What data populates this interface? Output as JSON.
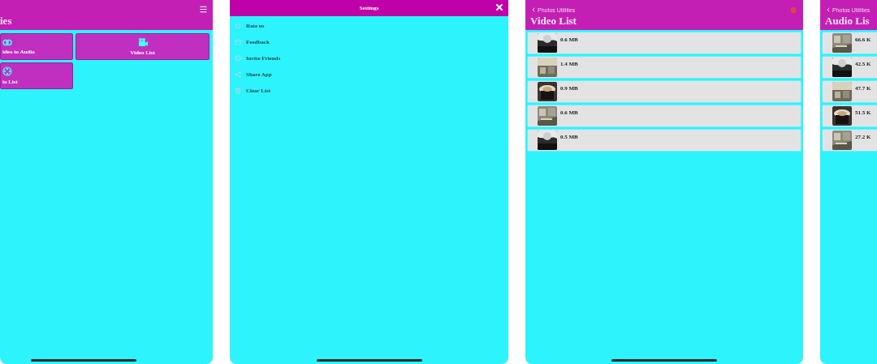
{
  "screens": [
    {
      "kind": "home",
      "title": "ies",
      "tiles": [
        {
          "label": "ideo to Audio"
        },
        {
          "label": "Video List"
        },
        {
          "label": "io List"
        }
      ]
    },
    {
      "kind": "settings",
      "title": "Settings",
      "items": [
        {
          "label": "Rate us"
        },
        {
          "label": "Feedback"
        },
        {
          "label": "Invite Friends"
        },
        {
          "label": "Share App"
        },
        {
          "label": "Clear List"
        }
      ]
    },
    {
      "kind": "list",
      "back": "Photos Utilities",
      "title": "Video List",
      "rows": [
        {
          "size": "0.6 MB"
        },
        {
          "size": "1.4 MB"
        },
        {
          "size": "0.9 MB"
        },
        {
          "size": "0.6 MB"
        },
        {
          "size": "0.5 MB"
        }
      ]
    },
    {
      "kind": "list",
      "back": "Photos Utilities",
      "title": "Audio Lis",
      "rows": [
        {
          "size": "66.6 K"
        },
        {
          "size": "42.5 K"
        },
        {
          "size": "47.7 K"
        },
        {
          "size": "51.5 K"
        },
        {
          "size": "27.2 K"
        }
      ]
    }
  ]
}
